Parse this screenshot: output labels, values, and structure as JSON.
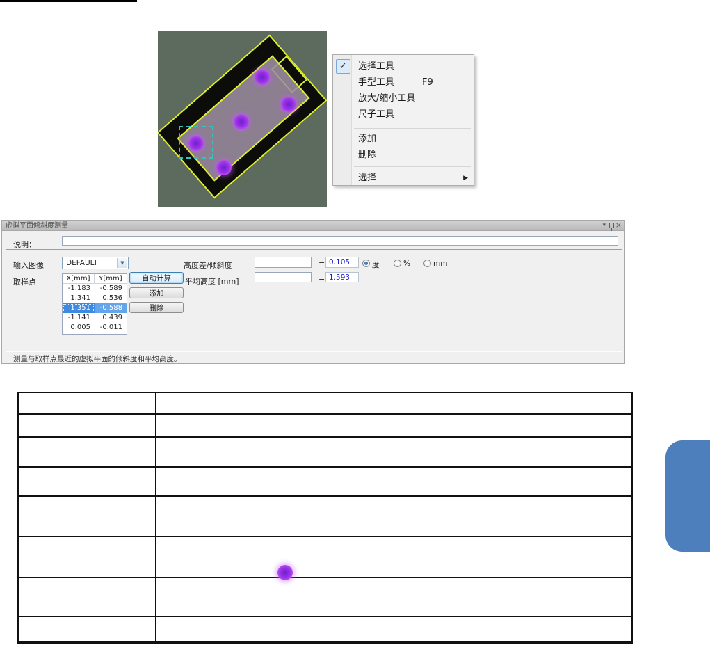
{
  "photo": {
    "background_color": "#5d6b5e",
    "chip_outline_color": "#def22c",
    "dot_color": "#9a2fe6",
    "selection_box_color": "#35c2b8"
  },
  "context_menu": {
    "check_glyph": "✓",
    "submenu_arrow": "▶",
    "items": [
      {
        "label": "选择工具",
        "checked": true
      },
      {
        "label": "手型工具",
        "shortcut": "F9"
      },
      {
        "label": "放大/缩小工具"
      },
      {
        "label": "尺子工具"
      },
      {
        "label": "添加"
      },
      {
        "label": "删除"
      },
      {
        "label": "选择",
        "has_submenu": true
      }
    ]
  },
  "dialog": {
    "title": "虚拟平面倾斜度测量",
    "titlebar": {
      "dropdown_glyph": "▾",
      "close_glyph": "×"
    },
    "description_label": "说明：",
    "description_value": "",
    "input_image_label": "输入图像",
    "input_image_value": "DEFAULT",
    "combo_arrow": "▼",
    "height_diff_label": "高度差/倾斜度",
    "height_diff_input": "",
    "equals": "=",
    "height_diff_value": "0.105",
    "value_color": "#2323d3",
    "radios": [
      {
        "label": "度",
        "selected": true
      },
      {
        "label": "%",
        "selected": false
      },
      {
        "label": "mm",
        "selected": false
      }
    ],
    "sample_points_label": "取样点",
    "points_table": {
      "headers": [
        "X[mm]",
        "Y[mm]"
      ],
      "rows": [
        [
          "-1.183",
          "-0.589"
        ],
        [
          "1.341",
          "0.536"
        ],
        [
          "1.351",
          "-0.588"
        ],
        [
          "-1.141",
          "0.439"
        ],
        [
          "0.005",
          "-0.011"
        ]
      ],
      "selected_row_index": 2
    },
    "auto_calc_button": "自动计算",
    "add_button": "添加",
    "delete_button": "删除",
    "avg_height_label": "平均高度 [mm]",
    "avg_height_input": "",
    "avg_height_value": "1.593",
    "status_text": "测量与取样点最近的虚拟平面的倾斜度和平均高度。"
  },
  "doc_table": {
    "rows": [
      [
        "",
        ""
      ],
      [
        "",
        ""
      ],
      [
        "",
        ""
      ],
      [
        "",
        ""
      ],
      [
        "",
        ""
      ],
      [
        "",
        ""
      ],
      [
        "",
        ""
      ],
      [
        "",
        ""
      ]
    ]
  },
  "blue_tab": {
    "color": "#4c7fbc"
  }
}
